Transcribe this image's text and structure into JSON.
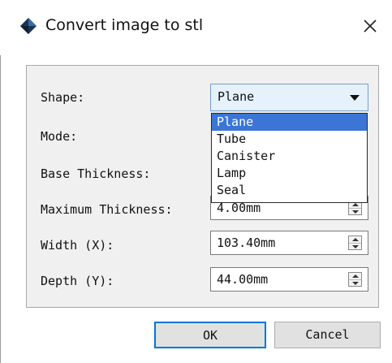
{
  "window": {
    "title": "Convert image to stl"
  },
  "form": {
    "shape_label": "Shape:",
    "mode_label": "Mode:",
    "base_thickness_label": "Base Thickness:",
    "maximum_thickness_label": "Maximum Thickness:",
    "width_label": "Width (X):",
    "depth_label": "Depth (Y):",
    "shape_value": "Plane",
    "maximum_thickness_value": "4.00mm",
    "width_value": "103.40mm",
    "depth_value": "44.00mm"
  },
  "dropdown": {
    "options": [
      "Plane",
      "Tube",
      "Canister",
      "Lamp",
      "Seal"
    ],
    "selected": "Plane"
  },
  "buttons": {
    "ok": "OK",
    "cancel": "Cancel"
  },
  "colors": {
    "accent": "#0078d7",
    "selection": "#3b75d6",
    "combo_bg": "#e5f1fb",
    "panel_bg": "#f0f0f0"
  }
}
